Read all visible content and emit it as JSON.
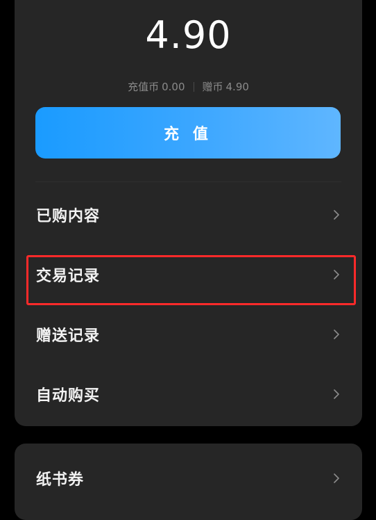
{
  "balance": "4.90",
  "wallet": {
    "recharge_coin_label": "充值币",
    "recharge_coin_value": "0.00",
    "gift_coin_label": "赠币",
    "gift_coin_value": "4.90"
  },
  "recharge_button": "充 值",
  "menu": [
    {
      "label": "已购内容",
      "icon": "chevron-right-icon"
    },
    {
      "label": "交易记录",
      "icon": "chevron-right-icon"
    },
    {
      "label": "赠送记录",
      "icon": "chevron-right-icon"
    },
    {
      "label": "自动购买",
      "icon": "chevron-right-icon"
    }
  ],
  "extra_menu": [
    {
      "label": "纸书券",
      "icon": "chevron-right-icon"
    }
  ],
  "colors": {
    "accent": "#1a9bff",
    "highlight": "#ff2a2a",
    "card": "#262626",
    "background": "#000000"
  }
}
